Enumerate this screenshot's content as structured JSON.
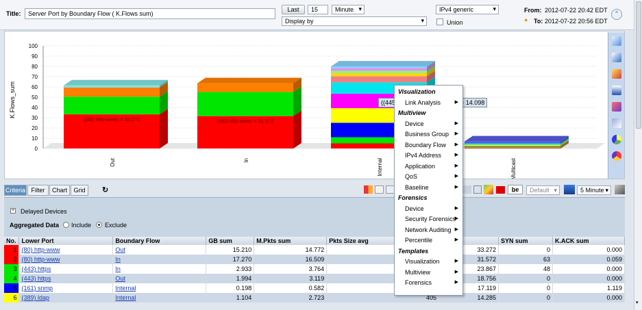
{
  "header": {
    "title_label": "Title:",
    "title_value": "Server Port by Boundary Flow ( K.Flows sum)",
    "last_label": "Last",
    "last_value": "15",
    "unit_value": "Minute",
    "display_by_label": "Display by",
    "ip_value": "IPv4 generic",
    "union_label": "Union",
    "from_label": "From:",
    "from_value": "2012-07-22 20:42 EDT",
    "to_label": "To:",
    "to_value": "2012-07-22 20:56 EDT"
  },
  "chart_data": {
    "type": "bar",
    "stacked": true,
    "ylabel": "K.Flows_sum",
    "ylim": [
      0,
      100
    ],
    "yticks": [
      "0",
      "10",
      "20",
      "30",
      "40",
      "50",
      "60",
      "70",
      "80",
      "90",
      "100"
    ],
    "categories": [
      "Out",
      "In",
      "Internal",
      "Multicast"
    ],
    "series": [
      {
        "color": "#ff0000",
        "values": [
          33.272,
          31.572,
          5,
          0.5
        ]
      },
      {
        "color": "#00e600",
        "values": [
          17.2,
          23.5,
          6,
          0.6
        ]
      },
      {
        "color": "#ff7f00",
        "values": [
          9,
          8.5,
          0,
          0.8
        ]
      },
      {
        "color": "#80e0e0",
        "values": [
          2,
          0,
          0,
          0
        ]
      },
      {
        "color": "#0000ff",
        "values": [
          0,
          0,
          14,
          0.4
        ]
      },
      {
        "color": "#ffff00",
        "values": [
          0,
          0,
          14.3,
          1.3
        ]
      },
      {
        "color": "#ff00ff",
        "values": [
          0,
          0,
          14.098,
          0
        ]
      },
      {
        "color": "#00e5ee",
        "values": [
          0,
          0,
          11,
          1.4
        ]
      },
      {
        "color": "#f08080",
        "values": [
          0,
          0,
          6,
          0
        ]
      },
      {
        "color": "#ffd700",
        "values": [
          0,
          0,
          3,
          0
        ]
      },
      {
        "color": "#90ee90",
        "values": [
          0,
          0,
          2.5,
          0
        ]
      },
      {
        "color": "#ee82ee",
        "values": [
          0,
          0,
          2,
          0
        ]
      },
      {
        "color": "#87cefa",
        "values": [
          0,
          0,
          2,
          0
        ]
      },
      {
        "color": "#5a5ae0",
        "values": [
          0,
          0,
          0,
          1.9
        ]
      }
    ],
    "data_labels": [
      "((80) http-www) = 33.272",
      "((80) http-www) = 31.572"
    ]
  },
  "tooltip": "((445) microsoft-ds, Internal) = 14.098",
  "tabs": [
    "Criteria",
    "Filter",
    "Chart",
    "Grid"
  ],
  "panel": {
    "delayed": "Delayed Devices",
    "aggregated": "Aggregated Data",
    "include": "Include",
    "exclude": "Exclude"
  },
  "controls": {
    "default": "Default",
    "interval": "5 Minute"
  },
  "grid": {
    "headers": [
      "No.",
      "Lower Port",
      "Boundary Flow",
      "GB sum",
      "M.Pkts sum",
      "Pkts Size avg",
      "",
      "SYN sum",
      "K.ACK sum"
    ],
    "rows": [
      {
        "no": "1",
        "color": "#ff0000",
        "port": "(80) http-www",
        "flow": "Out",
        "gb": "15.210",
        "mpkts": "14.772",
        "psize": "",
        "kflows": "33.272",
        "syn": "0",
        "kack": "0.000"
      },
      {
        "no": "2",
        "color": "#ff0000",
        "port": "(80) http-www",
        "flow": "In",
        "gb": "17.270",
        "mpkts": "16.509",
        "psize": "",
        "kflows": "31.572",
        "syn": "63",
        "kack": "0.059"
      },
      {
        "no": "3",
        "color": "#00e600",
        "port": "(443) https",
        "flow": "In",
        "gb": "2.933",
        "mpkts": "3.764",
        "psize": "",
        "kflows": "23.867",
        "syn": "48",
        "kack": "0.000"
      },
      {
        "no": "4",
        "color": "#00e600",
        "port": "(443) https",
        "flow": "Out",
        "gb": "1.994",
        "mpkts": "3.119",
        "psize": "",
        "kflows": "18.756",
        "syn": "0",
        "kack": "0.000"
      },
      {
        "no": "5",
        "color": "#0000ff",
        "port": "(161) snmp",
        "flow": "Internal",
        "gb": "0.198",
        "mpkts": "0.582",
        "psize": "",
        "kflows": "17.119",
        "syn": "0",
        "kack": "1.119"
      },
      {
        "no": "6",
        "color": "#ffff00",
        "port": "(389) ldap",
        "flow": "Internal",
        "gb": "1.104",
        "mpkts": "2.723",
        "psize": "405",
        "kflows": "14.285",
        "syn": "0",
        "kack": "0.000"
      }
    ]
  },
  "menu": [
    {
      "kind": "h",
      "label": "Visualization"
    },
    {
      "kind": "i",
      "label": "Link Analysis",
      "sub": true
    },
    {
      "kind": "h",
      "label": "Multiview"
    },
    {
      "kind": "i",
      "label": "Device",
      "sub": true
    },
    {
      "kind": "i",
      "label": "Business Group",
      "sub": true
    },
    {
      "kind": "i",
      "label": "Boundary Flow",
      "sub": true
    },
    {
      "kind": "i",
      "label": "IPv4 Address",
      "sub": true
    },
    {
      "kind": "i",
      "label": "Application",
      "sub": true
    },
    {
      "kind": "i",
      "label": "QoS",
      "sub": true
    },
    {
      "kind": "i",
      "label": "Baseline",
      "sub": true
    },
    {
      "kind": "h",
      "label": "Forensics"
    },
    {
      "kind": "i",
      "label": "Device",
      "sub": true
    },
    {
      "kind": "i",
      "label": "Security Forensics",
      "sub": true
    },
    {
      "kind": "i",
      "label": "Network Auditing",
      "sub": true
    },
    {
      "kind": "i",
      "label": "Percentile",
      "sub": true
    },
    {
      "kind": "h",
      "label": "Templates"
    },
    {
      "kind": "i",
      "label": "Visualization",
      "sub": true
    },
    {
      "kind": "i",
      "label": "Multiview",
      "sub": true
    },
    {
      "kind": "i",
      "label": "Forensics",
      "sub": true
    }
  ]
}
